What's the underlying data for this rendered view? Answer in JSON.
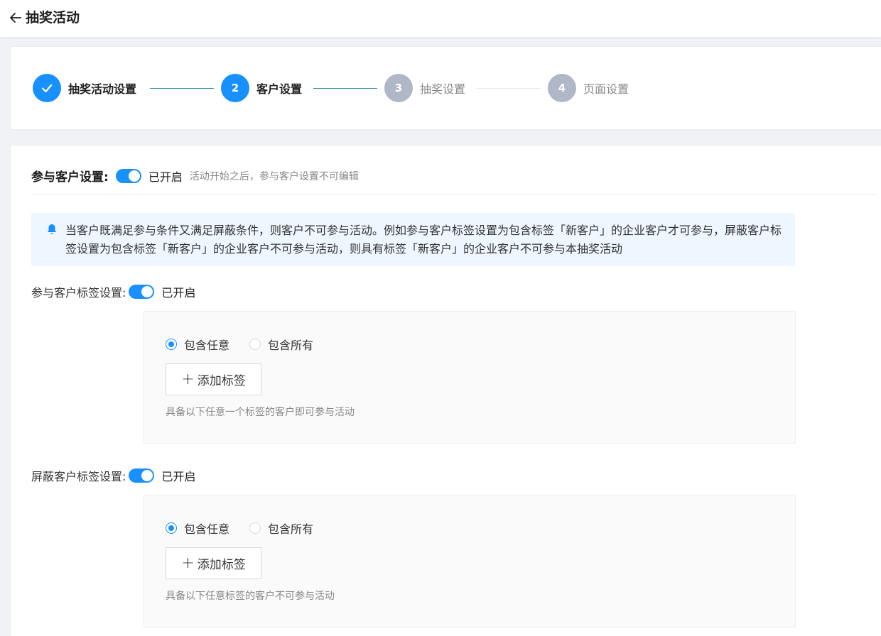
{
  "header": {
    "title": "抽奖活动"
  },
  "steps": [
    {
      "label": "抽奖活动设置",
      "number": "",
      "state": "done"
    },
    {
      "label": "客户设置",
      "number": "2",
      "state": "active"
    },
    {
      "label": "抽奖设置",
      "number": "3",
      "state": "inactive"
    },
    {
      "label": "页面设置",
      "number": "4",
      "state": "inactive"
    }
  ],
  "participate": {
    "label": "参与客户设置:",
    "status": "已开启",
    "hint": "活动开始之后，参与客户设置不可编辑"
  },
  "notice": {
    "text": "当客户既满足参与条件又满足屏蔽条件，则客户不可参与活动。例如参与客户标签设置为包含标签「新客户」的企业客户才可参与，屏蔽客户标签设置为包含标签「新客户」的企业客户不可参与活动，则具有标签「新客户」的企业客户不可参与本抽奖活动"
  },
  "include_tags": {
    "label": "参与客户标签设置:",
    "status": "已开启",
    "option_any": "包含任意",
    "option_all": "包含所有",
    "selected": "包含任意",
    "add_label": "添加标签",
    "hint": "具备以下任意一个标签的客户即可参与活动"
  },
  "exclude_tags": {
    "label": "屏蔽客户标签设置:",
    "status": "已开启",
    "option_any": "包含任意",
    "option_all": "包含所有",
    "selected": "包含任意",
    "add_label": "添加标签",
    "hint": "具备以下任意标签的客户不可参与活动"
  },
  "colors": {
    "primary": "#1890ff",
    "step_inactive": "#b0b8c8",
    "notice_bg": "#eef6ff"
  }
}
